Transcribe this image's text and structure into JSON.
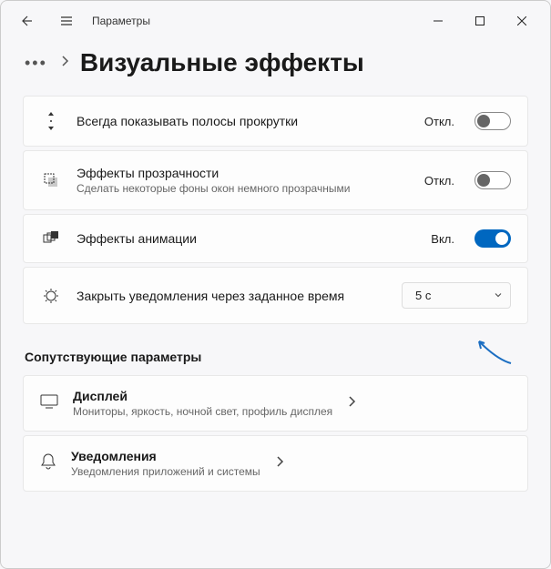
{
  "app": {
    "title": "Параметры"
  },
  "breadcrumb": {
    "page_title": "Визуальные эффекты"
  },
  "settings": [
    {
      "icon": "scrollbar-icon",
      "title": "Всегда показывать полосы прокрутки",
      "subtitle": null,
      "status": "Откл.",
      "toggle_on": false
    },
    {
      "icon": "transparency-icon",
      "title": "Эффекты прозрачности",
      "subtitle": "Сделать некоторые фоны окон немного прозрачными",
      "status": "Откл.",
      "toggle_on": false
    },
    {
      "icon": "animation-icon",
      "title": "Эффекты анимации",
      "subtitle": null,
      "status": "Вкл.",
      "toggle_on": true
    },
    {
      "icon": "notification-timer-icon",
      "title": "Закрыть уведомления через заданное время",
      "subtitle": null,
      "dropdown_value": "5 с"
    }
  ],
  "related": {
    "heading": "Сопутствующие параметры",
    "items": [
      {
        "icon": "display-icon",
        "title": "Дисплей",
        "subtitle": "Мониторы, яркость, ночной свет, профиль дисплея"
      },
      {
        "icon": "bell-icon",
        "title": "Уведомления",
        "subtitle": "Уведомления приложений и системы"
      }
    ]
  }
}
